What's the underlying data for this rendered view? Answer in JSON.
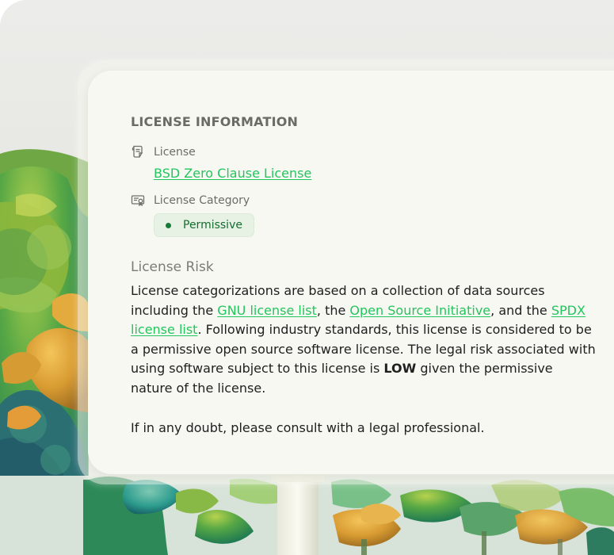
{
  "section_title": "LICENSE INFORMATION",
  "license": {
    "label": "License",
    "value": "BSD Zero Clause License",
    "icon": "license-document-icon"
  },
  "category": {
    "label": "License Category",
    "value": "Permissive",
    "icon": "license-certificate-icon"
  },
  "risk": {
    "heading": "License Risk",
    "intro": "License categorizations are based on a collection of data sources including the ",
    "link_gnu": "GNU license list",
    "text_after_gnu": ", the ",
    "link_osi": "Open Source Initiative",
    "text_after_osi": ", and the ",
    "link_spdx": "SPDX license list",
    "body": ". Following industry standards, this license is considered to be a permissive open source software license. The legal risk associated with using software subject to this license is ",
    "level": "LOW",
    "ending": " given the permissive nature of the license.",
    "note": "If in any doubt, please consult with a legal professional."
  },
  "colors": {
    "link": "#22c55e",
    "badge_bg": "#e7f2e5",
    "badge_text": "#146c2e",
    "card_bg": "#f8f8f2"
  }
}
